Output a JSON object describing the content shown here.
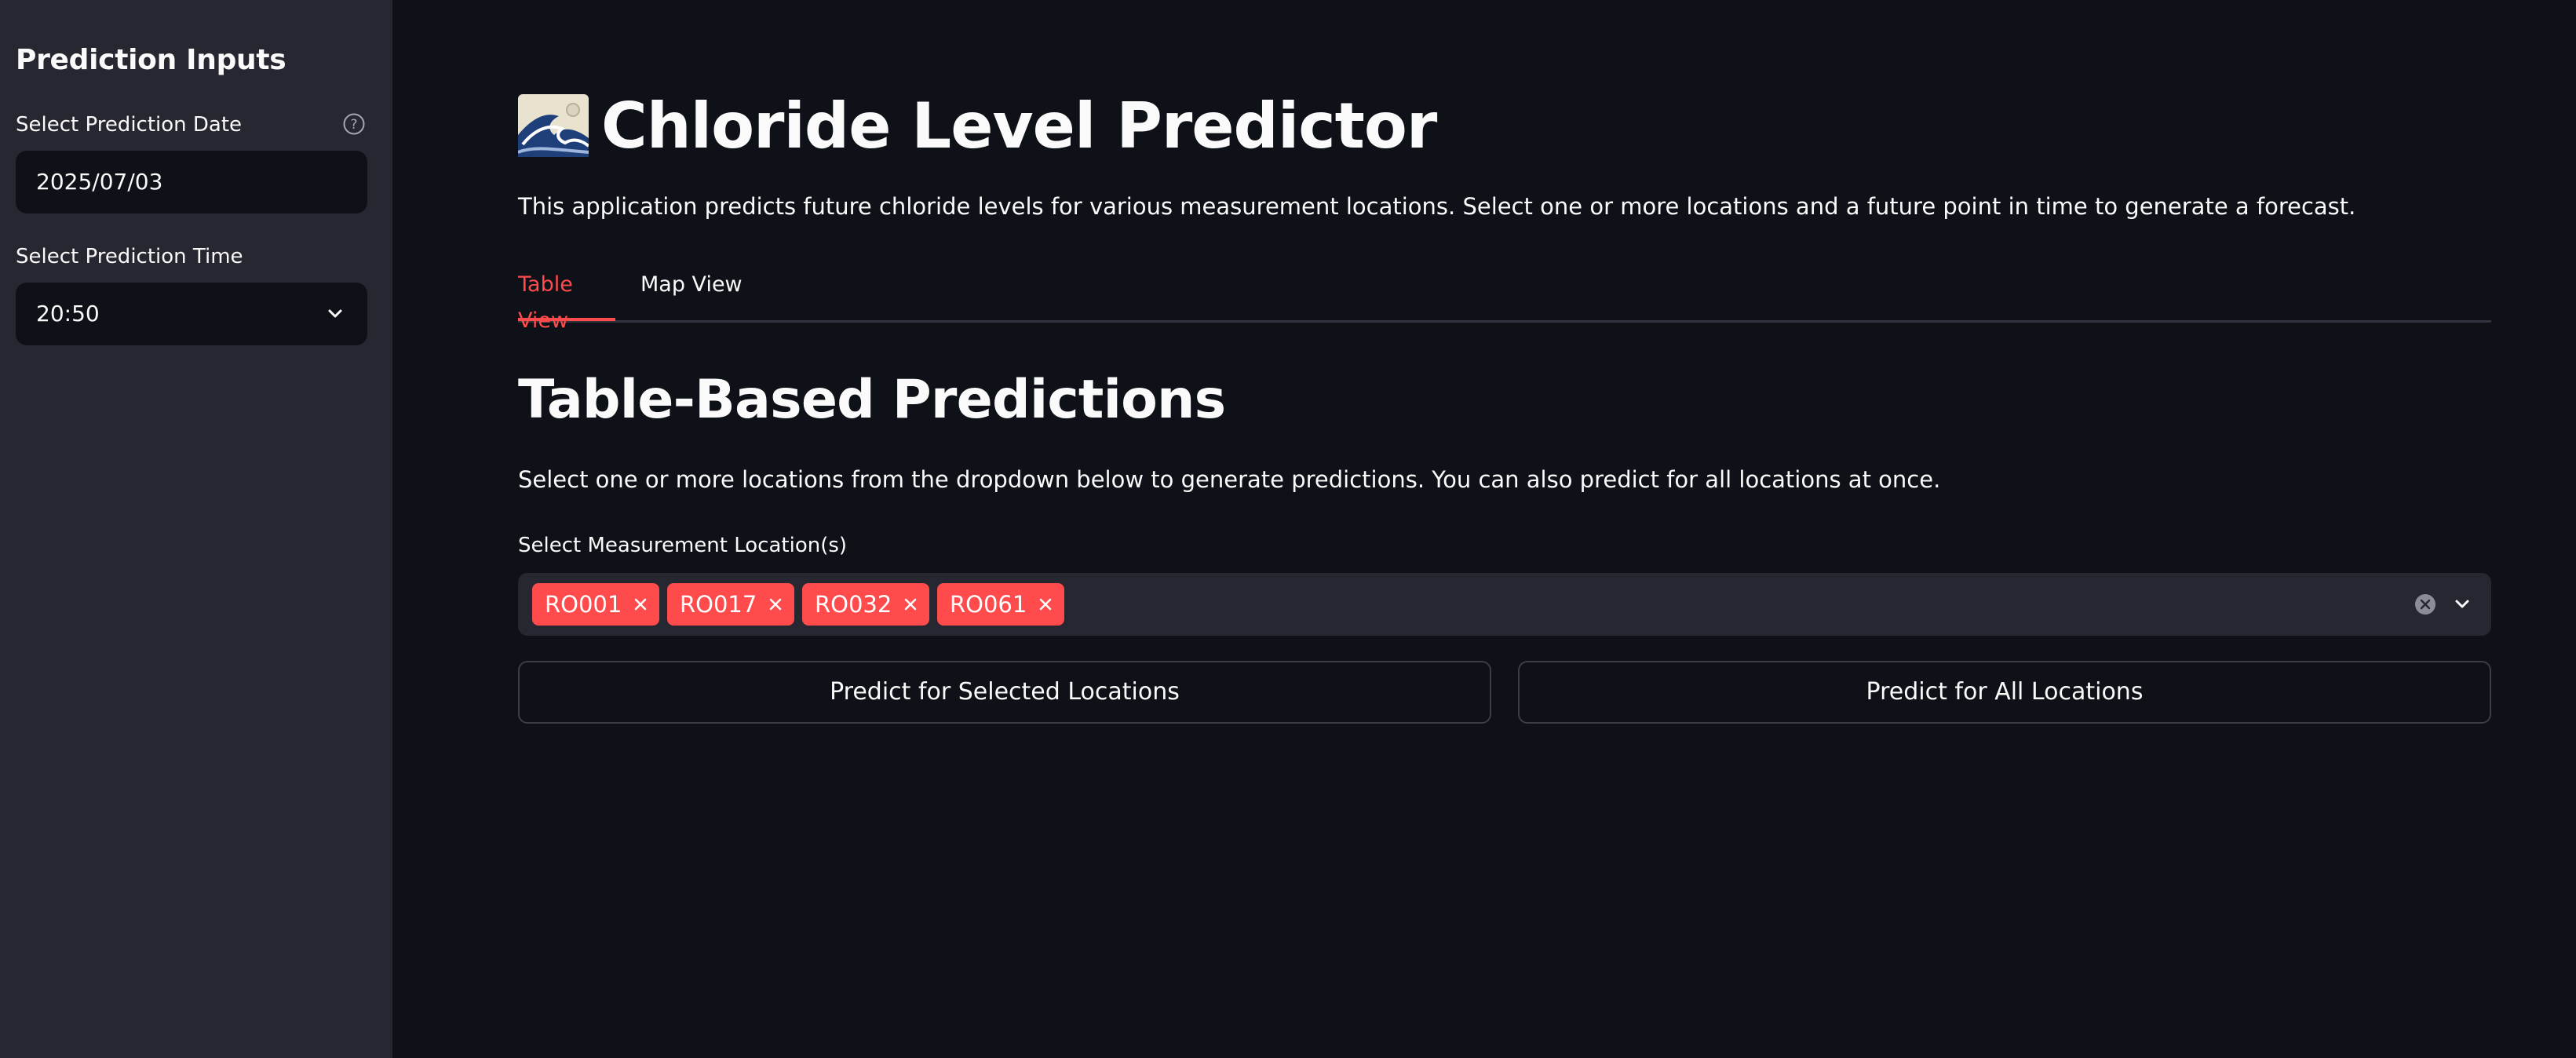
{
  "sidebar": {
    "title": "Prediction Inputs",
    "date_label": "Select Prediction Date",
    "date_value": "2025/07/03",
    "time_label": "Select Prediction Time",
    "time_value": "20:50"
  },
  "main": {
    "title": "Chloride Level Predictor",
    "title_icon": "wave-icon",
    "intro": "This application predicts future chloride levels for various measurement locations. Select one or more locations and a future point in time to generate a forecast.",
    "tabs": [
      {
        "label": "Table View",
        "active": true
      },
      {
        "label": "Map View",
        "active": false
      }
    ],
    "section_title": "Table-Based Predictions",
    "section_desc": "Select one or more locations from the dropdown below to generate predictions. You can also predict for all locations at once.",
    "locations_label": "Select Measurement Location(s)",
    "selected_locations": [
      "RO001",
      "RO017",
      "RO032",
      "RO061"
    ],
    "predict_selected_label": "Predict for Selected Locations",
    "predict_all_label": "Predict for All Locations"
  },
  "colors": {
    "background": "#0e1117",
    "sidebar": "#262730",
    "accent": "#ff4b4b",
    "text": "#fafafa"
  }
}
